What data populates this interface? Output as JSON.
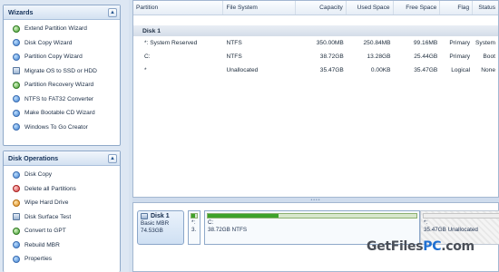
{
  "wizards": {
    "title": "Wizards",
    "items": [
      {
        "label": "Extend Partition Wizard",
        "icon": "extend-icon"
      },
      {
        "label": "Disk Copy Wizard",
        "icon": "disk-copy-icon"
      },
      {
        "label": "Partition Copy Wizard",
        "icon": "partition-copy-icon"
      },
      {
        "label": "Migrate OS to SSD or HDD",
        "icon": "migrate-icon"
      },
      {
        "label": "Partition Recovery Wizard",
        "icon": "recovery-icon"
      },
      {
        "label": "NTFS to FAT32 Converter",
        "icon": "convert-icon"
      },
      {
        "label": "Make Bootable CD Wizard",
        "icon": "cd-icon"
      },
      {
        "label": "Windows To Go Creator",
        "icon": "windows-icon"
      }
    ]
  },
  "disk_operations": {
    "title": "Disk Operations",
    "items": [
      {
        "label": "Disk Copy",
        "icon": "disk-copy-icon"
      },
      {
        "label": "Delete all Partitions",
        "icon": "delete-icon"
      },
      {
        "label": "Wipe Hard Drive",
        "icon": "wipe-icon"
      },
      {
        "label": "Disk Surface Test",
        "icon": "surface-test-icon"
      },
      {
        "label": "Convert to GPT",
        "icon": "convert-gpt-icon"
      },
      {
        "label": "Rebuild MBR",
        "icon": "rebuild-icon"
      },
      {
        "label": "Properties",
        "icon": "properties-icon"
      }
    ]
  },
  "table": {
    "columns": [
      "Partition",
      "File System",
      "Capacity",
      "Used Space",
      "Free Space",
      "Flag",
      "Status"
    ],
    "disk_label": "Disk 1",
    "rows": [
      {
        "partition": "*: System Reserved",
        "fs": "NTFS",
        "capacity": "350.00MB",
        "used": "250.84MB",
        "free": "99.16MB",
        "flag": "Primary",
        "status": "System"
      },
      {
        "partition": "C:",
        "fs": "NTFS",
        "capacity": "38.72GB",
        "used": "13.28GB",
        "free": "25.44GB",
        "flag": "Primary",
        "status": "Boot"
      },
      {
        "partition": "*",
        "fs": "Unallocated",
        "capacity": "35.47GB",
        "used": "0.00KB",
        "free": "35.47GB",
        "flag": "Logical",
        "status": "None"
      }
    ]
  },
  "disk_map": {
    "disk_name": "Disk 1",
    "disk_type": "Basic MBR",
    "disk_size": "74.53GB",
    "sys_block": {
      "label1": "*:",
      "label2": "3.",
      "used_fraction": 0.72
    },
    "c_block": {
      "name": "C:",
      "detail": "38.72GB NTFS",
      "used_fraction": 0.34
    },
    "unalloc_block": {
      "name": "*:",
      "detail": "35.47GB Unallocated"
    }
  },
  "watermark": {
    "part1": "GetFiles",
    "part2": "PC",
    "part3": ".com"
  },
  "colors": {
    "used": "#3ea22a",
    "accent": "#1f6fd1"
  }
}
